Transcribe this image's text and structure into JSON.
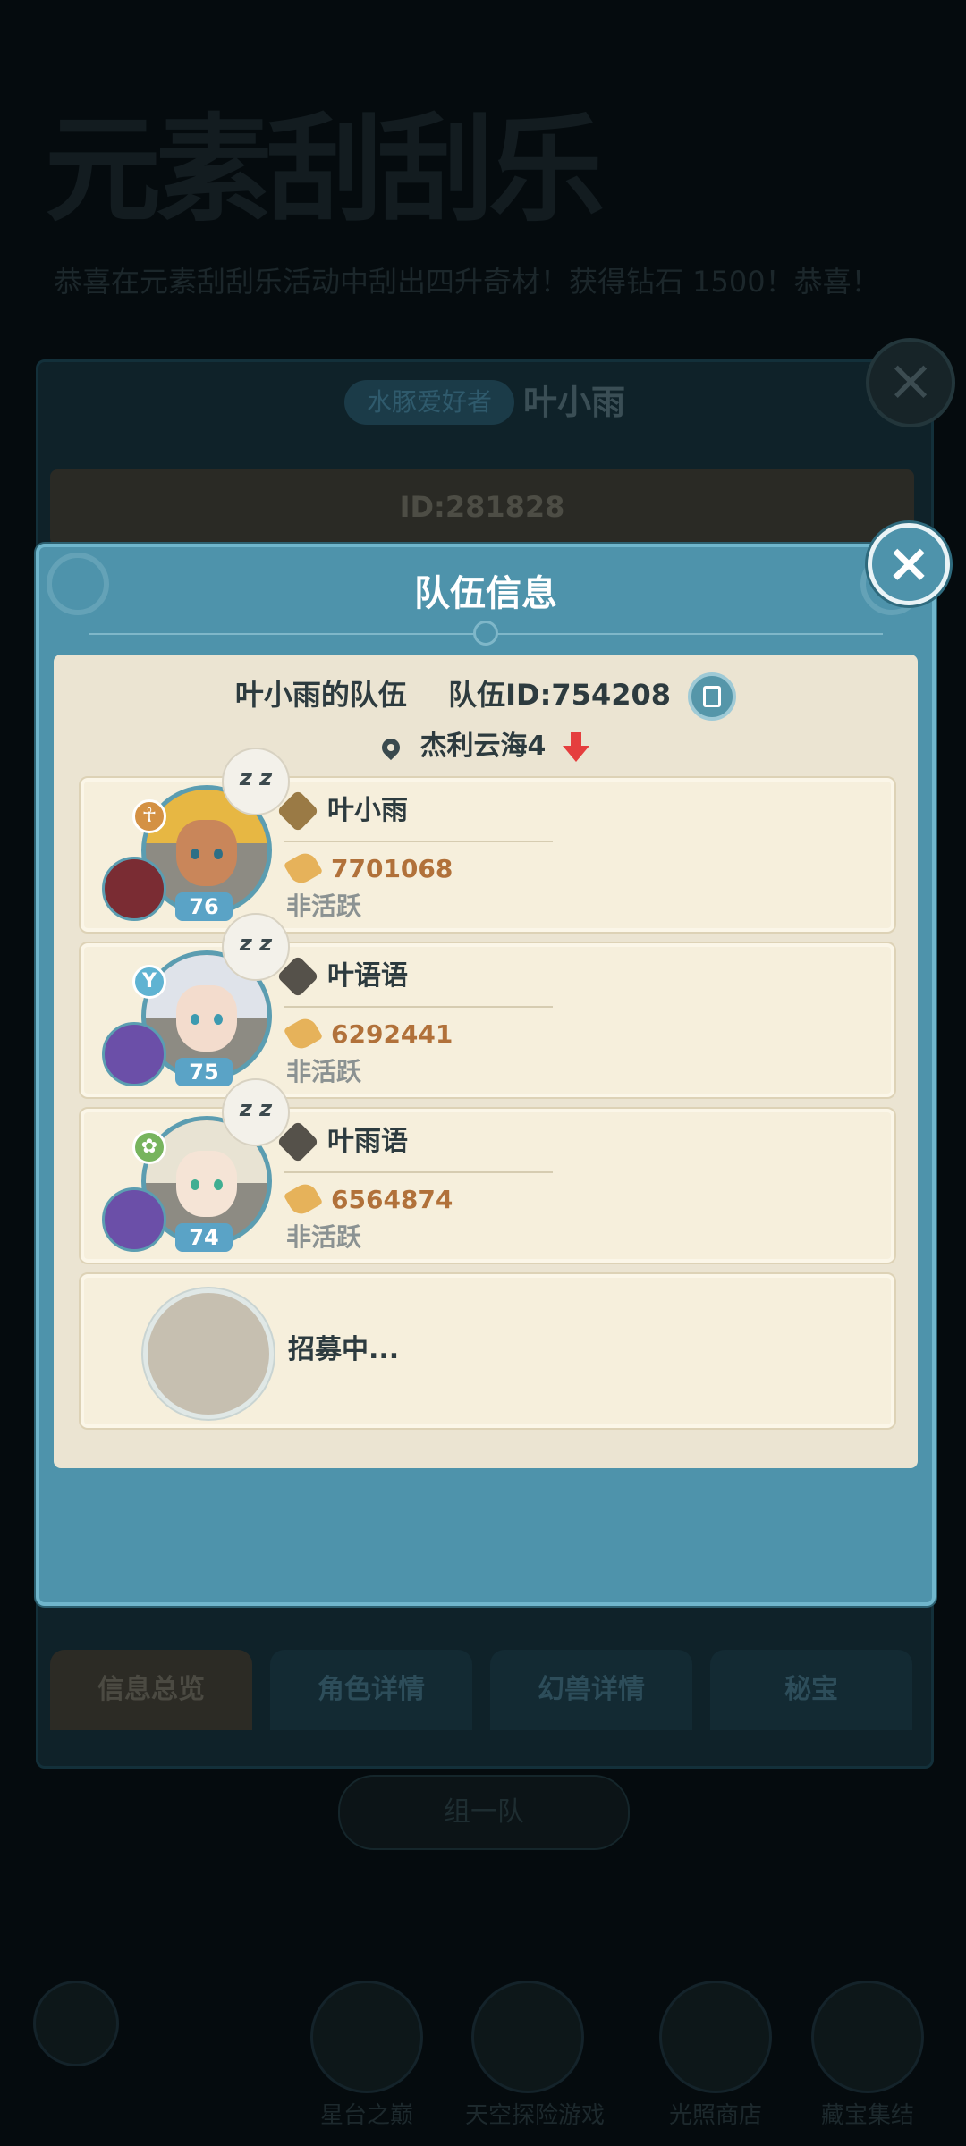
{
  "background": {
    "event_title": "元素刮刮乐",
    "banner_text": "恭喜在元素刮刮乐活动中刮出四升奇材！获得钻石 1500！恭喜！",
    "player_badge": "水豚爱好者",
    "player_name": "叶小雨",
    "player_id": "ID:281828",
    "tabs": [
      "信息总览",
      "角色详情",
      "幻兽详情",
      "秘宝"
    ],
    "bottom_pill": "组一队",
    "bottom_buttons": [
      "星台之巅",
      "天空探险游戏",
      "光照商店",
      "藏宝集结"
    ]
  },
  "modal": {
    "title": "队伍信息",
    "close_label": "×",
    "team_name": "叶小雨的队伍",
    "team_id": "队伍ID:754208",
    "location": "杰利云海4",
    "members": [
      {
        "name": "叶小雨",
        "level": "76",
        "power": "7701068",
        "status": "非活跃",
        "sleep": "z z",
        "class_symbol": "☥"
      },
      {
        "name": "叶语语",
        "level": "75",
        "power": "6292441",
        "status": "非活跃",
        "sleep": "z z",
        "class_symbol": "Y"
      },
      {
        "name": "叶雨语",
        "level": "74",
        "power": "6564874",
        "status": "非活跃",
        "sleep": "z z",
        "class_symbol": "✿"
      }
    ],
    "recruiting": "招募中..."
  }
}
